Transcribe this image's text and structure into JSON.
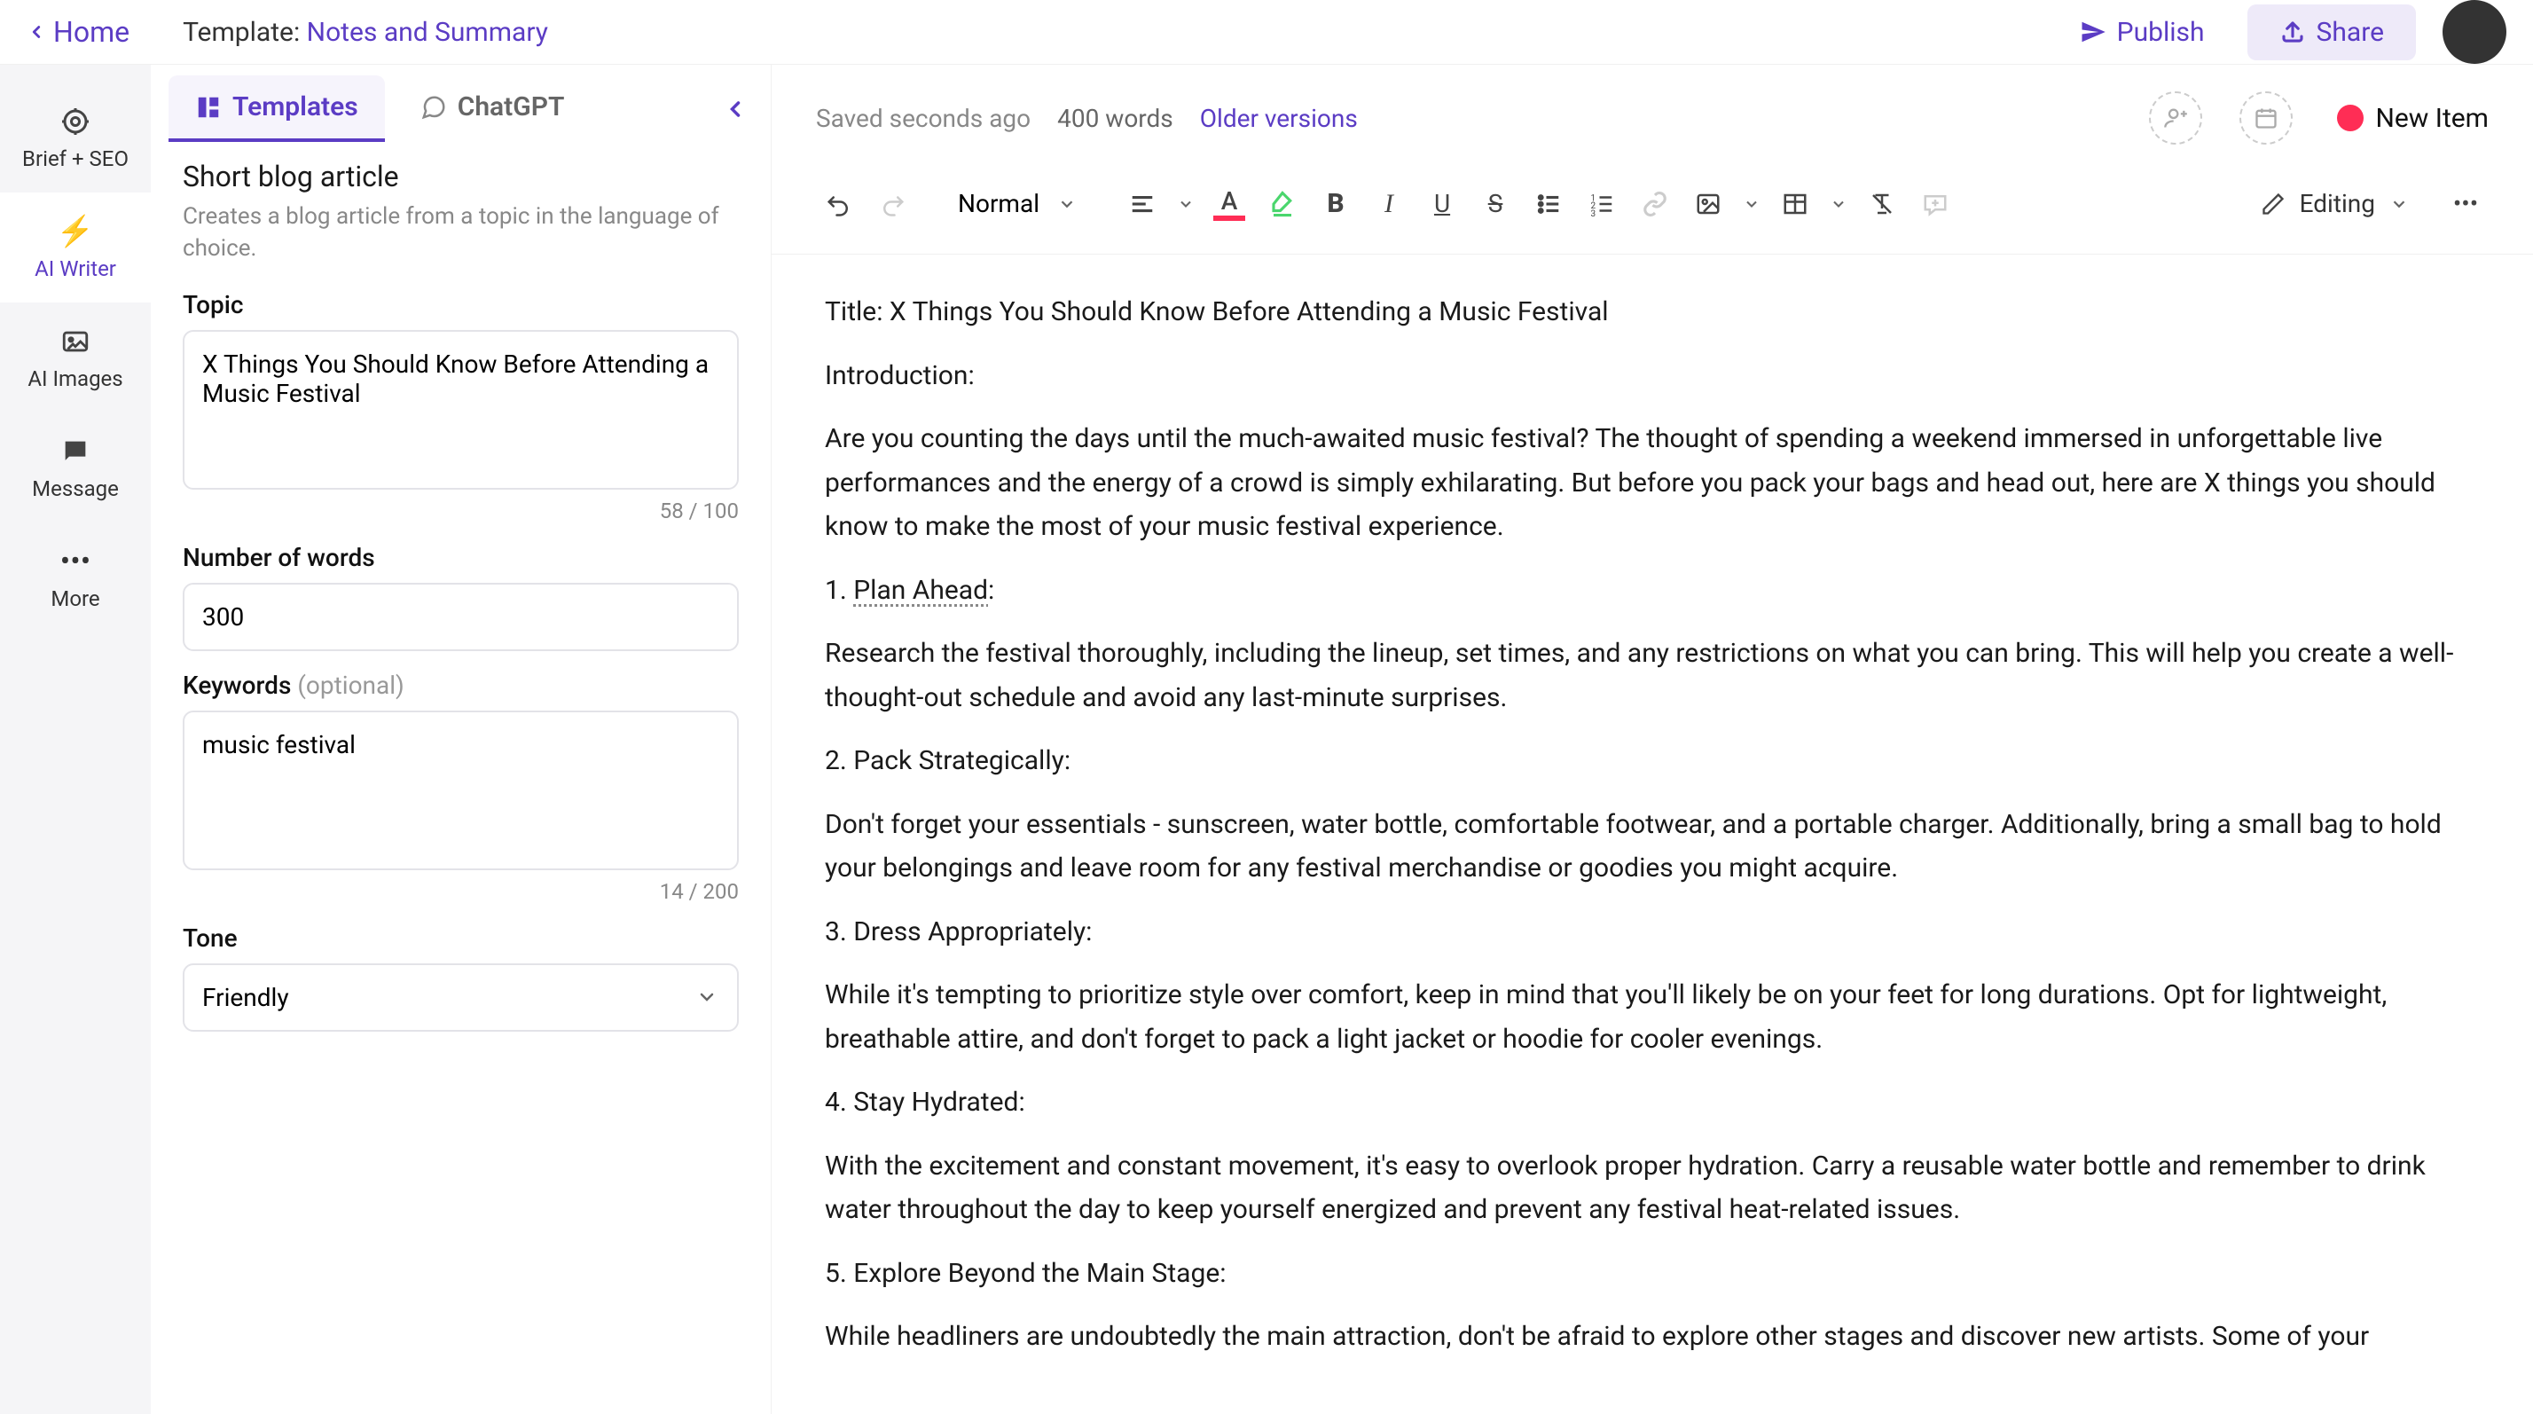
{
  "header": {
    "home": "Home",
    "template_prefix": "Template: ",
    "template_name": "Notes and Summary",
    "publish": "Publish",
    "share": "Share"
  },
  "rail": {
    "items": [
      {
        "label": "Brief + SEO"
      },
      {
        "label": "AI Writer"
      },
      {
        "label": "AI Images"
      },
      {
        "label": "Message"
      },
      {
        "label": "More"
      }
    ]
  },
  "tabs": {
    "templates": "Templates",
    "chatgpt": "ChatGPT"
  },
  "panel": {
    "title": "Short blog article",
    "desc": "Creates a blog article from a topic in the language of choice.",
    "topic_label": "Topic",
    "topic_value": "X Things You Should Know Before Attending a Music Festival",
    "topic_count": "58 / 100",
    "words_label": "Number of words",
    "words_value": "300",
    "keywords_label": "Keywords ",
    "keywords_optional": "(optional)",
    "keywords_value": "music festival",
    "keywords_count": "14 / 200",
    "tone_label": "Tone",
    "tone_value": "Friendly"
  },
  "editor": {
    "saved": "Saved seconds ago",
    "word_count": "400 words",
    "older": "Older versions",
    "new_item": "New Item",
    "style": "Normal",
    "editing": "Editing"
  },
  "doc": {
    "title_line": "Title: X Things You Should Know Before Attending a Music Festival",
    "intro_label": "Introduction:",
    "intro_body": "Are you counting the days until the much-awaited music festival? The thought of spending a weekend immersed in unforgettable live performances and the energy of a crowd is simply exhilarating. But before you pack your bags and head out, here are X things you should know to make the most of your music festival experience.",
    "h1_prefix": "1. ",
    "h1_underline": "Plan Ahead",
    "h1_suffix": ":",
    "p1": "Research the festival thoroughly, including the lineup, set times, and any restrictions on what you can bring. This will help you create a well-thought-out schedule and avoid any last-minute surprises.",
    "h2": "2. Pack Strategically:",
    "p2": "Don't forget your essentials - sunscreen, water bottle, comfortable footwear, and a portable charger. Additionally, bring a small bag to hold your belongings and leave room for any festival merchandise or goodies you might acquire.",
    "h3": "3. Dress Appropriately:",
    "p3": "While it's tempting to prioritize style over comfort, keep in mind that you'll likely be on your feet for long durations. Opt for lightweight, breathable attire, and don't forget to pack a light jacket or hoodie for cooler evenings.",
    "h4": "4. Stay Hydrated:",
    "p4": "With the excitement and constant movement, it's easy to overlook proper hydration. Carry a reusable water bottle and remember to drink water throughout the day to keep yourself energized and prevent any festival heat-related issues.",
    "h5": "5. Explore Beyond the Main Stage:",
    "p5": "While headliners are undoubtedly the main attraction, don't be afraid to explore other stages and discover new artists. Some of your"
  }
}
